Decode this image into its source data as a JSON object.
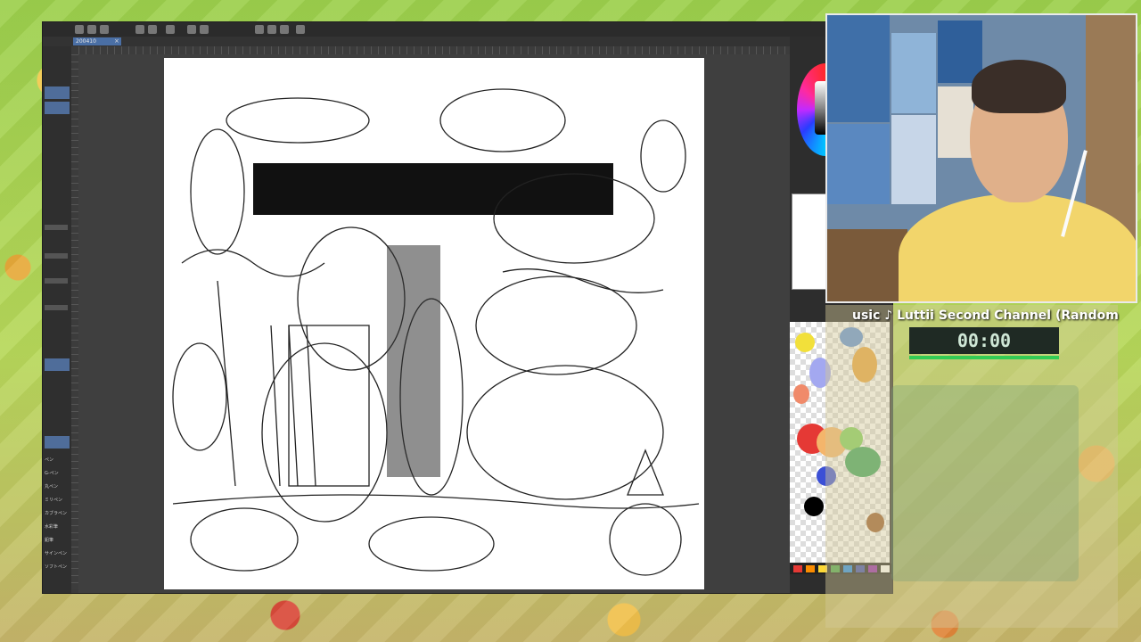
{
  "app": {
    "document_tab": "200410",
    "toolbar_icons": [
      "new-icon",
      "open-icon",
      "save-icon",
      "undo-icon",
      "redo-icon",
      "settings-icon",
      "brush-icon",
      "select-icon"
    ],
    "left_panel_labels": [
      "ペン",
      "G-ペン",
      "丸ペン",
      "ミリペン",
      "カブラペン",
      "水彩筆",
      "鉛筆",
      "サインペン",
      "ソフトペン"
    ]
  },
  "stream": {
    "ticker_text": "usic ♪ Luttii Second Channel (Random S",
    "timer": "00:00"
  },
  "colors": {
    "palette": [
      "#e53935",
      "#fb8c00",
      "#fdd835",
      "#43a047",
      "#1e88e5",
      "#3949ab",
      "#8e24aa",
      "#ffffff"
    ],
    "swatch_blobs": [
      "#f2e03a",
      "#5b8fd8",
      "#f08a6a",
      "#a3a8f0",
      "#e9a23a",
      "#e53935",
      "#f4b56b",
      "#7fcf5a",
      "#3aa35a",
      "#3b4fd6",
      "#000000",
      "#9a5a2a"
    ]
  }
}
